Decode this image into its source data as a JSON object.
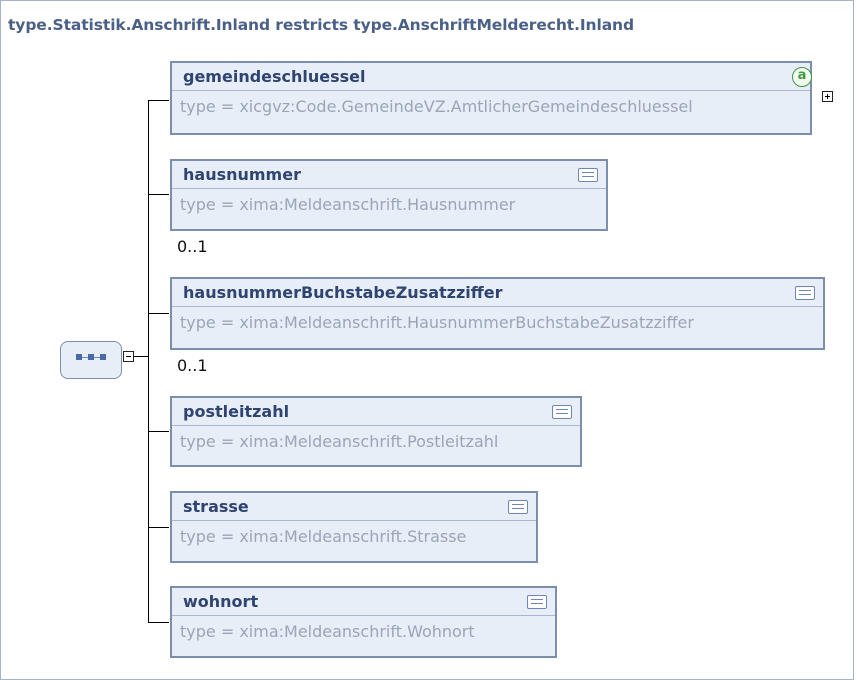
{
  "diagram": {
    "title": "type.Statistik.Anschrift.Inland restricts type.AnschriftMelderecht.Inland",
    "elements": [
      {
        "name": "gemeindeschluessel",
        "type": "type = xicgvz:Code.GemeindeVZ.AmtlicherGemeindeschluessel",
        "icon": "attribute-icon",
        "expandable": true
      },
      {
        "name": "hausnummer",
        "type": "type = xima:Meldeanschrift.Hausnummer",
        "icon": "documentation-icon",
        "cardinality": "0..1"
      },
      {
        "name": "hausnummerBuchstabeZusatzziffer",
        "type": "type = xima:Meldeanschrift.HausnummerBuchstabeZusatzziffer",
        "icon": "documentation-icon",
        "cardinality": "0..1"
      },
      {
        "name": "postleitzahl",
        "type": "type = xima:Meldeanschrift.Postleitzahl",
        "icon": "documentation-icon"
      },
      {
        "name": "strasse",
        "type": "type = xima:Meldeanschrift.Strasse",
        "icon": "documentation-icon"
      },
      {
        "name": "wohnort",
        "type": "type = xima:Meldeanschrift.Wohnort",
        "icon": "documentation-icon"
      }
    ],
    "attribute_icon_glyph": "a"
  }
}
